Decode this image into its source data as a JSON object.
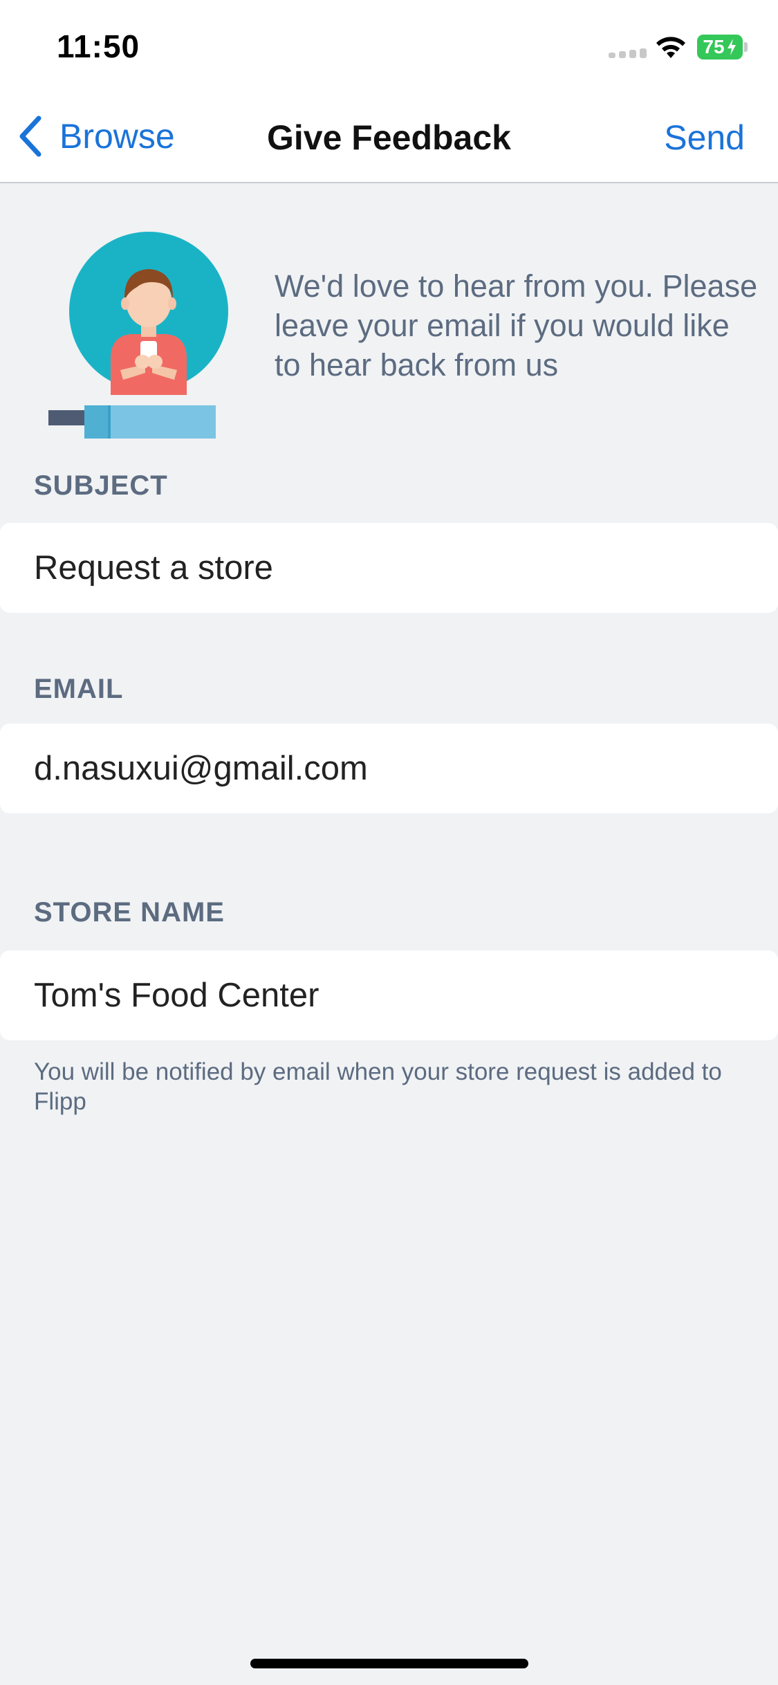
{
  "status_bar": {
    "time": "11:50",
    "battery": "75",
    "battery_color": "#34c759"
  },
  "nav": {
    "back_label": "Browse",
    "title": "Give Feedback",
    "send_label": "Send",
    "accent_color": "#1a73d9"
  },
  "intro": {
    "text": "We'd love to hear from you. Please leave your email if you would like to hear back from us"
  },
  "form": {
    "subject": {
      "label": "SUBJECT",
      "value": "Request a store"
    },
    "email": {
      "label": "EMAIL",
      "value": "d.nasuxui@gmail.com"
    },
    "store_name": {
      "label": "STORE NAME",
      "value": "Tom's Food Center"
    },
    "footnote": "You will be notified by email when your store request is added to Flipp"
  },
  "icons": [
    "back-chevron-icon",
    "wifi-icon",
    "signal-icon",
    "battery-icon",
    "feedback-illustration"
  ]
}
